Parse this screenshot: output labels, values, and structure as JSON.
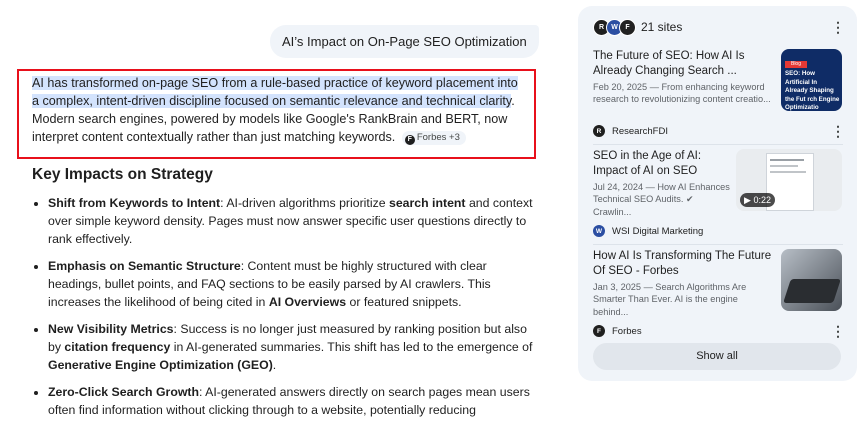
{
  "query": {
    "text": "AI’s Impact on On-Page SEO Optimization"
  },
  "answer": {
    "highlighted": "AI has transformed on-page SEO from a rule-based practice of keyword placement into a complex, intent-driven discipline focused on semantic relevance and technical clarity",
    "rest": ". Modern search engines, powered by models like Google's RankBrain and BERT, now interpret content contextually rather than just matching keywords.",
    "citation": "Forbes +3"
  },
  "section_title": "Key Impacts on Strategy",
  "points": [
    {
      "title": "Shift from Keywords to Intent",
      "parts": [
        ": AI-driven algorithms prioritize ",
        "search intent",
        " and context over simple keyword density. Pages must now answer specific user questions directly to rank effectively."
      ]
    },
    {
      "title": "Emphasis on Semantic Structure",
      "parts": [
        ": Content must be highly structured with clear headings, bullet points, and FAQ sections to be easily parsed by AI crawlers. This increases the likelihood of being cited in ",
        "AI Overviews",
        " or featured snippets."
      ]
    },
    {
      "title": "New Visibility Metrics",
      "parts": [
        ": Success is no longer just measured by ranking position but also by ",
        "citation frequency",
        " in AI-generated summaries. This shift has led to the emergence of ",
        "Generative Engine Optimization (GEO)",
        "."
      ]
    },
    {
      "title": "Zero-Click Search Growth",
      "parts": [
        ": AI-generated answers directly on search pages mean users often find information without clicking through to a website, potentially reducing"
      ]
    }
  ],
  "sources": {
    "count_label": "21 sites",
    "cards": [
      {
        "title": "The Future of SEO: How AI Is Already Changing Search ...",
        "meta": "Feb 20, 2025 — From enhancing keyword research to revolutionizing content creatio...",
        "source": "ResearchFDI",
        "thumb_text": "SEO: How Artificial In Already Shaping the Fut rch Engine Optimizatio",
        "thumb_tag": "Blog"
      },
      {
        "title": "SEO in the Age of AI: Impact of AI on SEO",
        "meta": "Jul 24, 2024 — How AI Enhances Technical SEO Audits. ✔ Crawlin...",
        "source": "WSI Digital Marketing",
        "duration": "0:22"
      },
      {
        "title": "How AI Is Transforming The Future Of SEO - Forbes",
        "meta": "Jan 3, 2025 — Search Algorithms Are Smarter Than Ever. AI is the engine behind...",
        "source": "Forbes"
      }
    ],
    "show_all": "Show all"
  },
  "colors": {
    "highlight": "#d3e3fd",
    "annotation_box": "#e8101b",
    "panel_bg": "#f0f4f9"
  }
}
